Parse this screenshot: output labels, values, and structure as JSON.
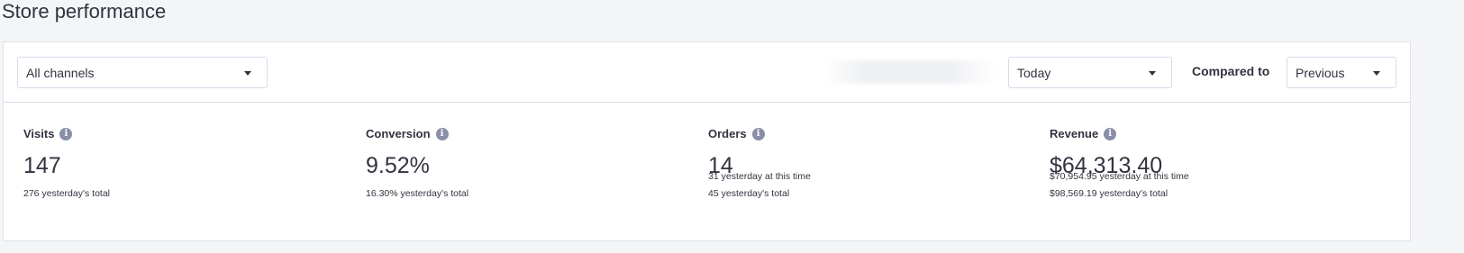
{
  "page": {
    "title": "Store performance"
  },
  "filters": {
    "channel": "All channels",
    "period": "Today",
    "compared_to_label": "Compared to",
    "compared_to": "Previous"
  },
  "metrics": [
    {
      "label": "Visits",
      "value": "147",
      "lines": [
        {
          "value": "276",
          "text": "yesterday's total"
        }
      ]
    },
    {
      "label": "Conversion",
      "value": "9.52%",
      "lines": [
        {
          "value": "16.30%",
          "text": "yesterday's total"
        }
      ]
    },
    {
      "label": "Orders",
      "value": "14",
      "lines": [
        {
          "value": "31",
          "text": "yesterday at this time"
        },
        {
          "value": "45",
          "text": "yesterday's total"
        }
      ]
    },
    {
      "label": "Revenue",
      "value": "$64,313.40",
      "lines": [
        {
          "value": "$70,954.95",
          "text": "yesterday at this time"
        },
        {
          "value": "$98,569.19",
          "text": "yesterday's total"
        }
      ]
    }
  ],
  "icons": {
    "info": "info-icon",
    "dropdown": "chevron-down-icon"
  },
  "colors": {
    "background": "#f4f5f7",
    "card": "#ffffff",
    "text": "#313440",
    "info_icon": "#8a8fa8",
    "border": "#d9dbe9"
  }
}
